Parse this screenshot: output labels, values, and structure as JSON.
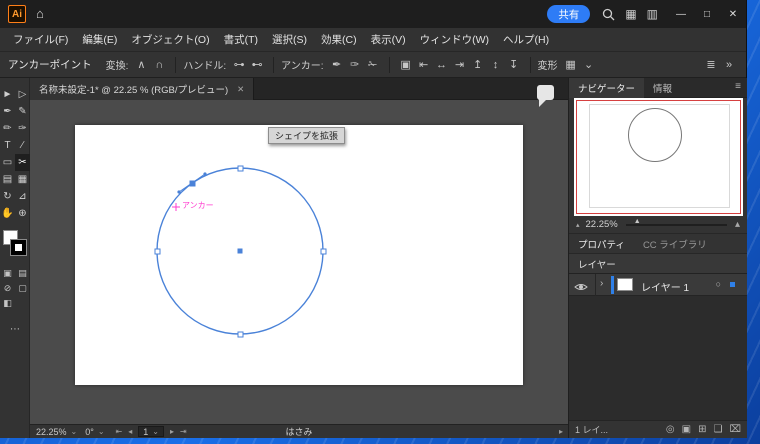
{
  "titlebar": {
    "app_icon": "Ai",
    "home_icon": "⌂",
    "share_button": "共有",
    "layout_icons": [
      "▦",
      "▥"
    ],
    "window_controls": {
      "minimize": "—",
      "maximize": "□",
      "close": "✕"
    }
  },
  "menubar": {
    "items": [
      "ファイル(F)",
      "編集(E)",
      "オブジェクト(O)",
      "書式(T)",
      "選択(S)",
      "効果(C)",
      "表示(V)",
      "ウィンドウ(W)",
      "ヘルプ(H)"
    ]
  },
  "control_bar": {
    "context_label": "アンカーポイント",
    "convert_label": "変換:",
    "convert_icons": [
      "∧",
      "∩"
    ],
    "handle_label": "ハンドル:",
    "handle_icons": [
      "⊶",
      "⊷"
    ],
    "anchor_label": "アンカー:",
    "anchor_icons": [
      "✒",
      "✑",
      "✁"
    ],
    "tool_icons": [
      "▣"
    ],
    "align_icons": [
      "⇤",
      "↔",
      "⇥",
      "↥",
      "↕",
      "↧"
    ],
    "transform_label": "変形",
    "transform_icons": [
      "▦",
      "⌄"
    ],
    "right_icons": [
      "≣",
      "»"
    ]
  },
  "document_tab": {
    "title": "名称未設定-1* @ 22.25 % (RGB/プレビュー)",
    "close_icon": "✕"
  },
  "toolbar": {
    "tools": [
      {
        "name": "selection",
        "glyph": "►"
      },
      {
        "name": "direct-selection",
        "glyph": "▷"
      },
      {
        "name": "pen",
        "glyph": "✒"
      },
      {
        "name": "curvature",
        "glyph": "✎"
      },
      {
        "name": "paintbrush",
        "glyph": "✏"
      },
      {
        "name": "pencil",
        "glyph": "✑"
      },
      {
        "name": "type",
        "glyph": "T"
      },
      {
        "name": "line",
        "glyph": "∕"
      },
      {
        "name": "rectangle",
        "glyph": "▭"
      },
      {
        "name": "scissors",
        "glyph": "✂"
      },
      {
        "name": "gradient",
        "glyph": "▤"
      },
      {
        "name": "mesh",
        "glyph": "▦"
      },
      {
        "name": "rotate",
        "glyph": "↻"
      },
      {
        "name": "scale",
        "glyph": "⊿"
      },
      {
        "name": "hand",
        "glyph": "✋"
      },
      {
        "name": "zoom",
        "glyph": "⊕"
      }
    ],
    "bottom_tools": [
      "▣",
      "▤",
      "⊘",
      "▢",
      "◧"
    ],
    "more_icon": "⋯"
  },
  "canvas": {
    "tooltip": "シェイプを拡張",
    "smart_guide_label": "アンカー"
  },
  "navigator": {
    "tab_navigator": "ナビゲーター",
    "tab_info": "情報",
    "menu_icon": "≡",
    "zoom_value": "22.25%",
    "zoom_out_icon": "▴",
    "zoom_in_icon": "▴",
    "thumb_icon": "▲"
  },
  "properties": {
    "tab_properties": "プロパティ",
    "tab_libraries": "CC ライブラリ"
  },
  "layers": {
    "panel_title": "レイヤー",
    "disclosure_icon": "›",
    "layer_name": "レイヤー 1",
    "target_icon": "○",
    "count_label": "1 レイ...",
    "bottom_icons": [
      "◎",
      "▣",
      "⊞",
      "❏",
      "⌧"
    ]
  },
  "statusbar": {
    "zoom_value": "22.25%",
    "caret_icon": "⌄",
    "rotation_value": "0°",
    "nav_icons": [
      "⇤",
      "◂",
      "▸",
      "⇥"
    ],
    "page_value": "1",
    "tool_name": "はさみ",
    "expand_icon": "▸"
  },
  "colors": {
    "selection_blue": "#4a82d8",
    "accent_blue": "#2e7cf6",
    "smart_guide_magenta": "#ff3bcf",
    "navigator_proxy_red": "#d64040"
  }
}
